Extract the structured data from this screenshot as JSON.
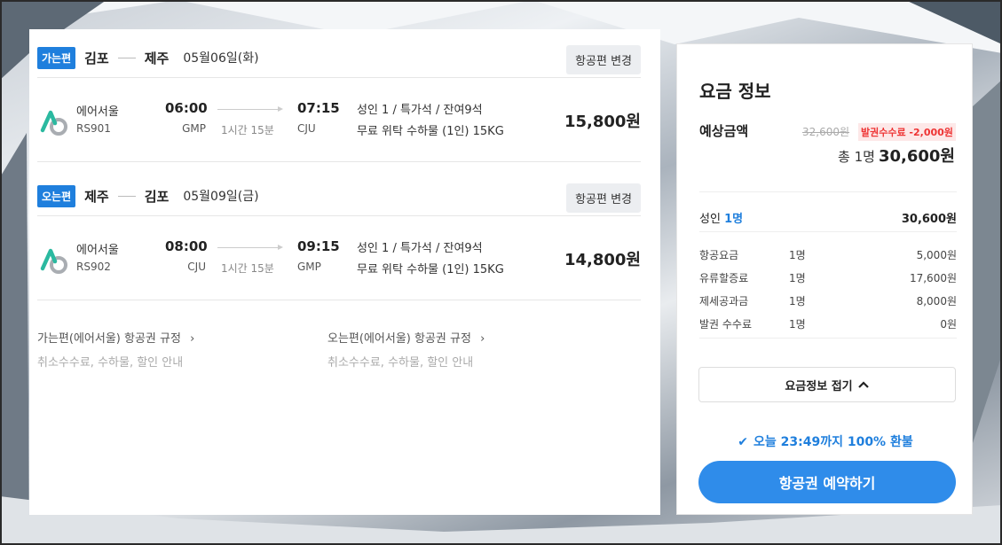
{
  "outbound": {
    "badge": "가는편",
    "from": "김포",
    "to": "제주",
    "date": "05월06일(화)",
    "change_label": "항공편 변경",
    "airline": "에어서울",
    "flight_no": "RS901",
    "dep_time": "06:00",
    "dep_code": "GMP",
    "duration": "1시간 15분",
    "arr_time": "07:15",
    "arr_code": "CJU",
    "seat_info": "성인 1 / 특가석 / 잔여9석",
    "baggage": "무료 위탁 수하물 (1인) 15KG",
    "price": "15,800원"
  },
  "inbound": {
    "badge": "오는편",
    "from": "제주",
    "to": "김포",
    "date": "05월09일(금)",
    "change_label": "항공편 변경",
    "airline": "에어서울",
    "flight_no": "RS902",
    "dep_time": "08:00",
    "dep_code": "CJU",
    "duration": "1시간 15분",
    "arr_time": "09:15",
    "arr_code": "GMP",
    "seat_info": "성인 1 / 특가석 / 잔여9석",
    "baggage": "무료 위탁 수하물 (1인) 15KG",
    "price": "14,800원"
  },
  "rules": {
    "outbound_title": "가는편(에어서울) 항공권 규정",
    "outbound_sub": "취소수수료, 수하물, 할인 안내",
    "inbound_title": "오는편(에어서울) 항공권 규정",
    "inbound_sub": "취소수수료, 수하물, 할인 안내"
  },
  "fare": {
    "title": "요금 정보",
    "est_label": "예상금액",
    "orig_price": "32,600원",
    "fee_badge": "발권수수료 -2,000원",
    "total_prefix": "총 1명",
    "total": "30,600원",
    "adult_label": "성인",
    "adult_count": "1명",
    "adult_amount": "30,600원",
    "items": [
      {
        "label": "항공요금",
        "qty": "1명",
        "amount": "5,000원"
      },
      {
        "label": "유류할증료",
        "qty": "1명",
        "amount": "17,600원"
      },
      {
        "label": "제세공과금",
        "qty": "1명",
        "amount": "8,000원"
      },
      {
        "label": "발권 수수료",
        "qty": "1명",
        "amount": "0원"
      }
    ],
    "fold_label": "요금정보 접기",
    "refund_text": "오늘 23:49까지 100% 환불",
    "book_label": "항공권 예약하기"
  },
  "colors": {
    "accent": "#1f7fdd",
    "book_button": "#2f8cea",
    "fee_red": "#e33333"
  }
}
